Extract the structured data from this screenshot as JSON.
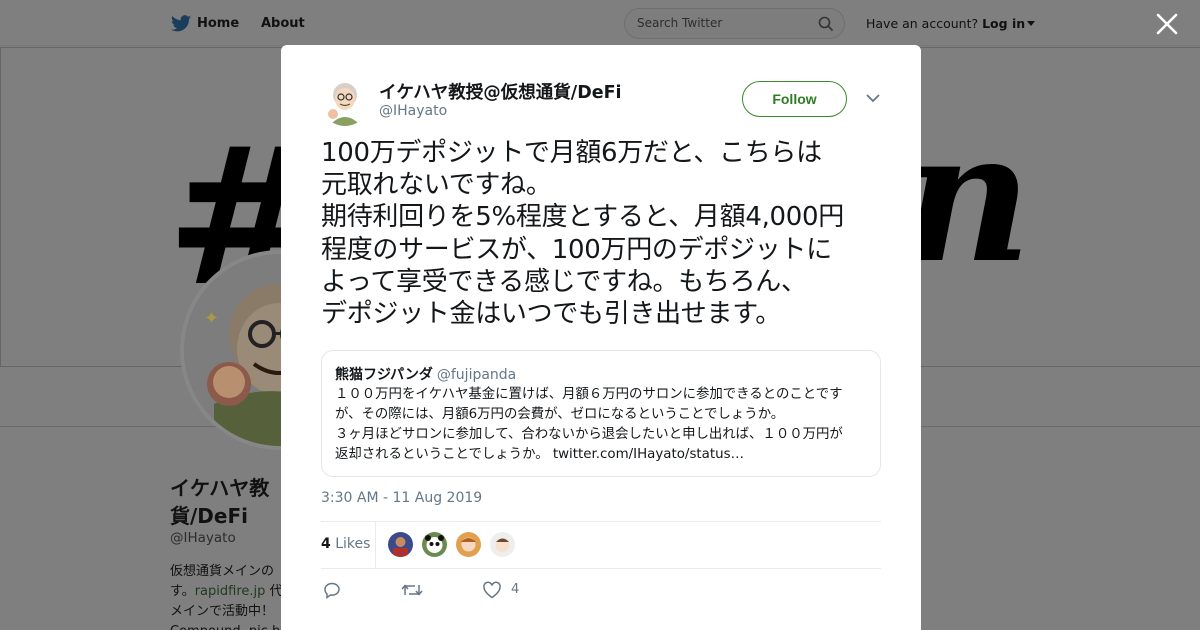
{
  "nav": {
    "home_label": "Home",
    "about_label": "About",
    "search_placeholder": "Search Twitter",
    "have_account": "Have an account?",
    "login_label": "Log in"
  },
  "background_profile": {
    "name": "イケハヤ教授@仮想通貨/DeFi",
    "name_visible": "イケハヤ教\n貨/DeFi",
    "handle": "@IHayato",
    "bio_line1": "仮想通貨メインの",
    "bio_line2_pre": "す。",
    "bio_link": "rapidfire.jp",
    "bio_line2_post": " 代",
    "bio_line3": "メインで活動中！",
    "bio_line4": "Compound, pic by",
    "banner_hash": "#",
    "banner_right": "n"
  },
  "tweet": {
    "author_name": "イケハヤ教授@仮想通貨/DeFi",
    "author_handle": "@IHayato",
    "follow_label": "Follow",
    "text": "100万デポジットで月額6万だと、こちらは\n元取れないですね。\n期待利回りを5%程度とすると、月額4,000円\n程度のサービスが、100万円のデポジットに\nよって享受できる感じですね。もちろん、\nデポジット金はいつでも引き出せます。",
    "timestamp": "3:30 AM - 11 Aug 2019",
    "likes_count": "4",
    "likes_label": "Likes",
    "like_action_count": "4"
  },
  "quoted": {
    "name": "熊猫フジパンダ",
    "handle": "@fujipanda",
    "text": "１００万円をイケハヤ基金に置けば、月額６万円のサロンに参加できるとのことです\nが、その際には、月額6万円の会費が、ゼロになるということでしょうか。\n３ヶ月ほどサロンに参加して、合わないから退会したいと申し出れば、１００万円が\n返却されるということでしょうか。 twitter.com/IHayato/status…"
  },
  "colors": {
    "follow_green": "#2e7d22",
    "muted_text": "#657786",
    "dim_overlay": "#7f7f7f"
  }
}
